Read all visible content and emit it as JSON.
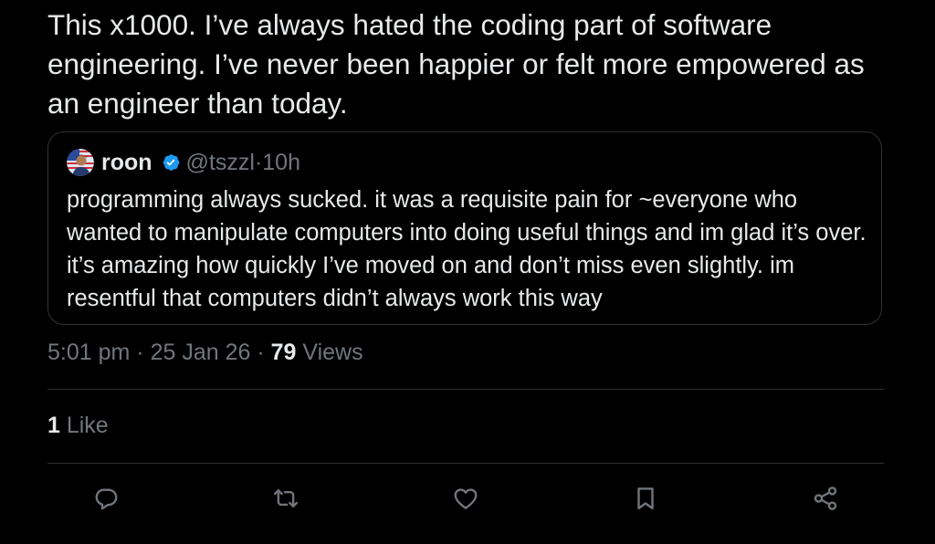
{
  "post": {
    "text": "This x1000. I’ve always hated the coding part of software engineering. I’ve never been happier or felt more empowered as an engineer than today."
  },
  "quote": {
    "name": "roon",
    "handle": "@tszzl",
    "separator": " · ",
    "age": "10h",
    "text": "programming always sucked. it was a requisite pain for ~everyone who wanted to manipulate computers into doing useful things and im glad it’s over. it’s amazing how quickly I’ve moved on and don’t miss even slightly. im resentful that computers didn’t always work this way",
    "verified_color": "#1d9bf0"
  },
  "meta": {
    "time": "5:01 pm",
    "sep1": " · ",
    "date": "25 Jan 26",
    "sep2": " · ",
    "views_count": "79",
    "views_label": " Views"
  },
  "likes": {
    "count": "1",
    "label": " Like"
  },
  "actions": [
    {
      "icon": "reply-icon"
    },
    {
      "icon": "retweet-icon"
    },
    {
      "icon": "like-icon"
    },
    {
      "icon": "bookmark-icon"
    },
    {
      "icon": "share-icon"
    }
  ],
  "colors": {
    "background": "#000000",
    "text": "#e7e9ea",
    "muted": "#71767b",
    "border": "#2f3336"
  }
}
